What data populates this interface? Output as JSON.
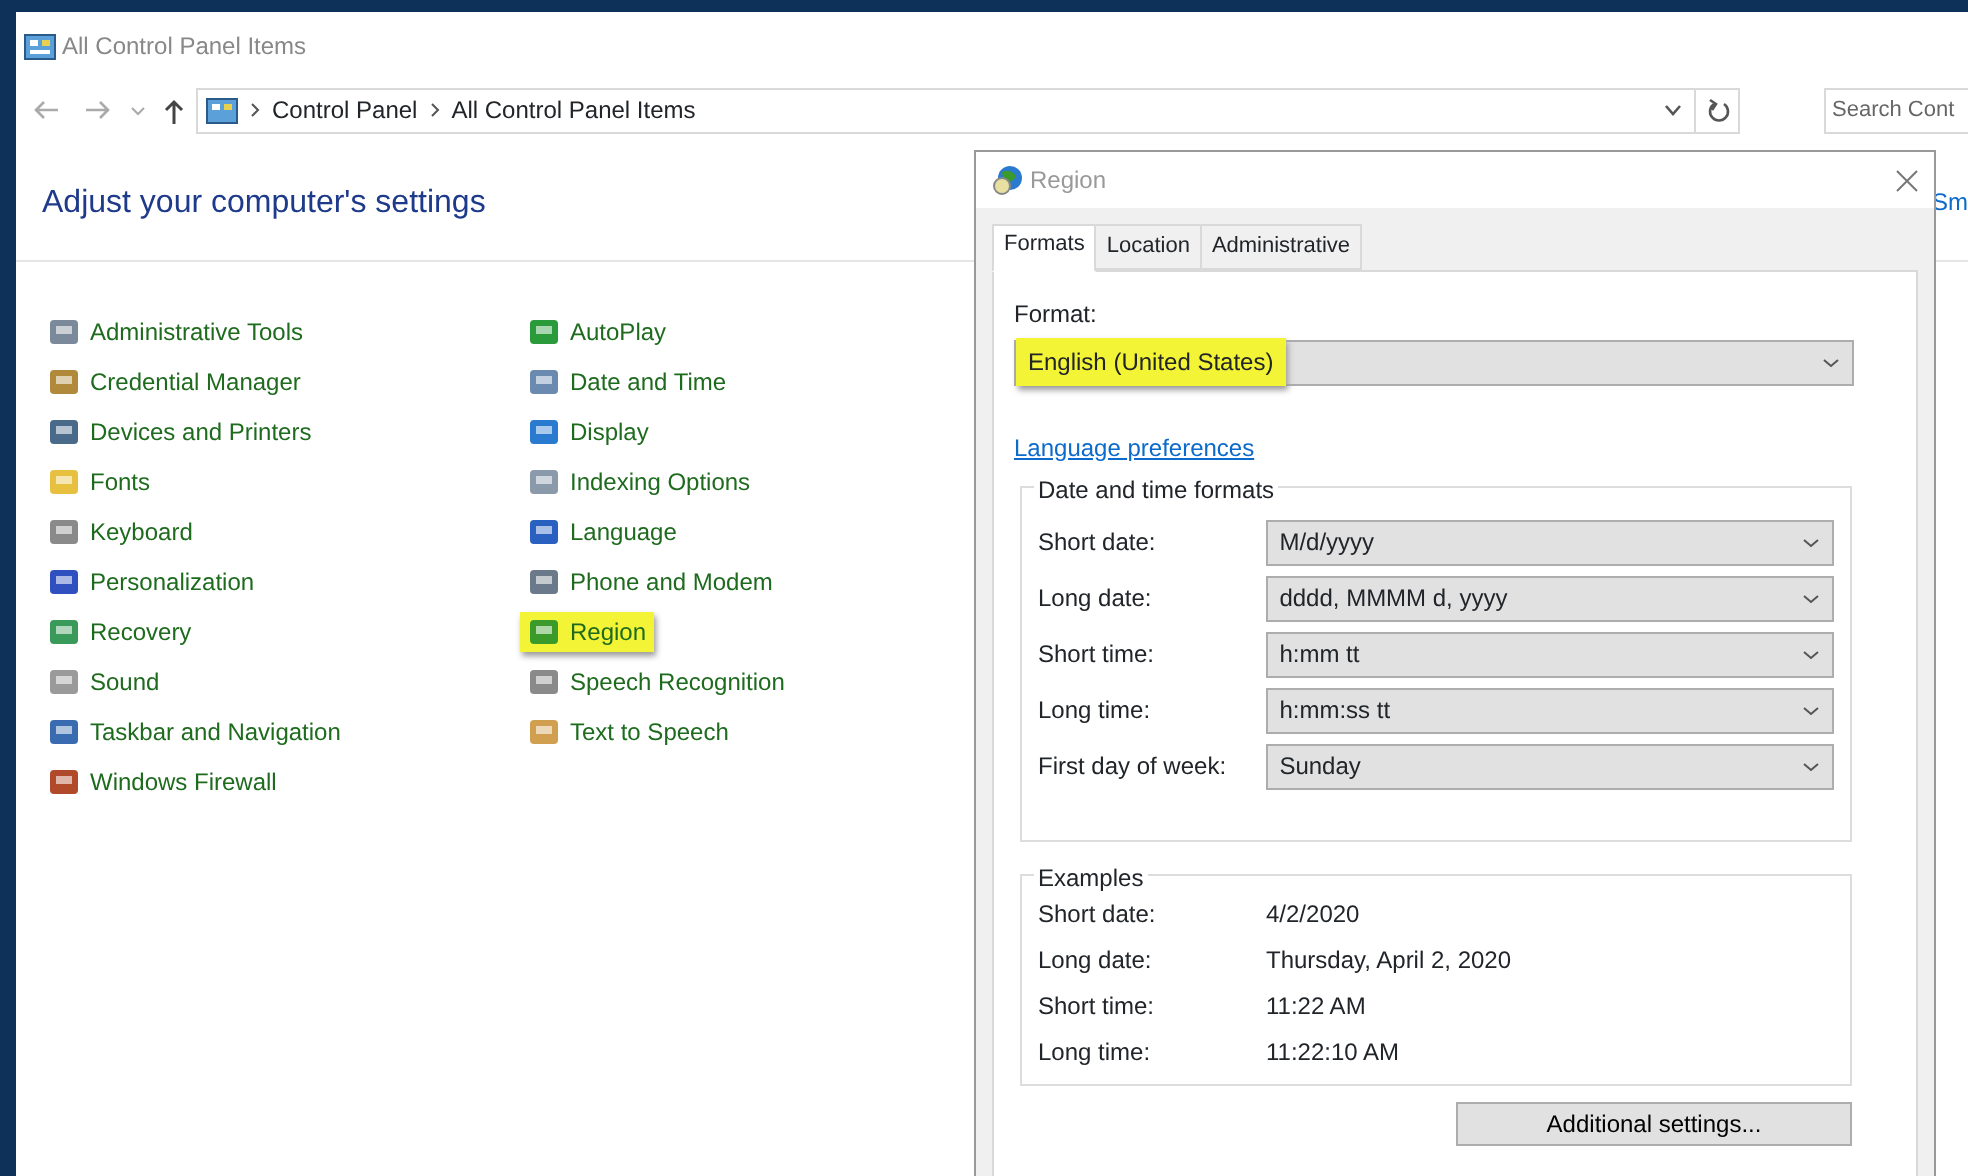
{
  "window": {
    "title": "All Control Panel Items"
  },
  "address_bar": {
    "crumbs": [
      "Control Panel",
      "All Control Panel Items"
    ]
  },
  "search": {
    "placeholder": "Search Cont"
  },
  "heading": "Adjust your computer's settings",
  "view_by": "Sm",
  "items": [
    {
      "label": "Administrative Tools",
      "highlighted": false,
      "color": "#7a8a9a"
    },
    {
      "label": "Credential Manager",
      "highlighted": false,
      "color": "#b08a3a"
    },
    {
      "label": "Devices and Printers",
      "highlighted": false,
      "color": "#4a6a8a"
    },
    {
      "label": "Fonts",
      "highlighted": false,
      "color": "#e8c040"
    },
    {
      "label": "Keyboard",
      "highlighted": false,
      "color": "#8a8a8a"
    },
    {
      "label": "Personalization",
      "highlighted": false,
      "color": "#3050c0"
    },
    {
      "label": "Recovery",
      "highlighted": false,
      "color": "#3a9a5a"
    },
    {
      "label": "Sound",
      "highlighted": false,
      "color": "#9a9a9a"
    },
    {
      "label": "Taskbar and Navigation",
      "highlighted": false,
      "color": "#3a6ab0"
    },
    {
      "label": "Windows Firewall",
      "highlighted": false,
      "color": "#b04a2a"
    },
    {
      "label": "AutoPlay",
      "highlighted": false,
      "color": "#2a9a3a"
    },
    {
      "label": "Date and Time",
      "highlighted": false,
      "color": "#6a8ab0"
    },
    {
      "label": "Display",
      "highlighted": false,
      "color": "#2a7ad0"
    },
    {
      "label": "Indexing Options",
      "highlighted": false,
      "color": "#8a9aaa"
    },
    {
      "label": "Language",
      "highlighted": false,
      "color": "#2a60c0"
    },
    {
      "label": "Phone and Modem",
      "highlighted": false,
      "color": "#6a7a8a"
    },
    {
      "label": "Region",
      "highlighted": true,
      "color": "#3a9a2a"
    },
    {
      "label": "Speech Recognition",
      "highlighted": false,
      "color": "#8a8a8a"
    },
    {
      "label": "Text to Speech",
      "highlighted": false,
      "color": "#d0a050"
    }
  ],
  "dialog": {
    "title": "Region",
    "tabs": [
      {
        "label": "Formats",
        "selected": true
      },
      {
        "label": "Location",
        "selected": false
      },
      {
        "label": "Administrative",
        "selected": false
      }
    ],
    "format_label": "Format:",
    "format": {
      "value": "English (United States)",
      "highlighted": true
    },
    "link": "Language preferences",
    "formats_group": {
      "title": "Date and time formats",
      "rows": [
        {
          "label": "Short date:",
          "value": "M/d/yyyy"
        },
        {
          "label": "Long date:",
          "value": "dddd, MMMM d, yyyy"
        },
        {
          "label": "Short time:",
          "value": "h:mm tt"
        },
        {
          "label": "Long time:",
          "value": "h:mm:ss tt"
        },
        {
          "label": "First day of week:",
          "value": "Sunday"
        }
      ]
    },
    "examples_group": {
      "title": "Examples",
      "rows": [
        {
          "label": "Short date:",
          "value": "4/2/2020"
        },
        {
          "label": "Long date:",
          "value": "Thursday, April 2, 2020"
        },
        {
          "label": "Short time:",
          "value": "11:22 AM"
        },
        {
          "label": "Long time:",
          "value": "11:22:10 AM"
        }
      ]
    },
    "button": "Additional settings..."
  }
}
